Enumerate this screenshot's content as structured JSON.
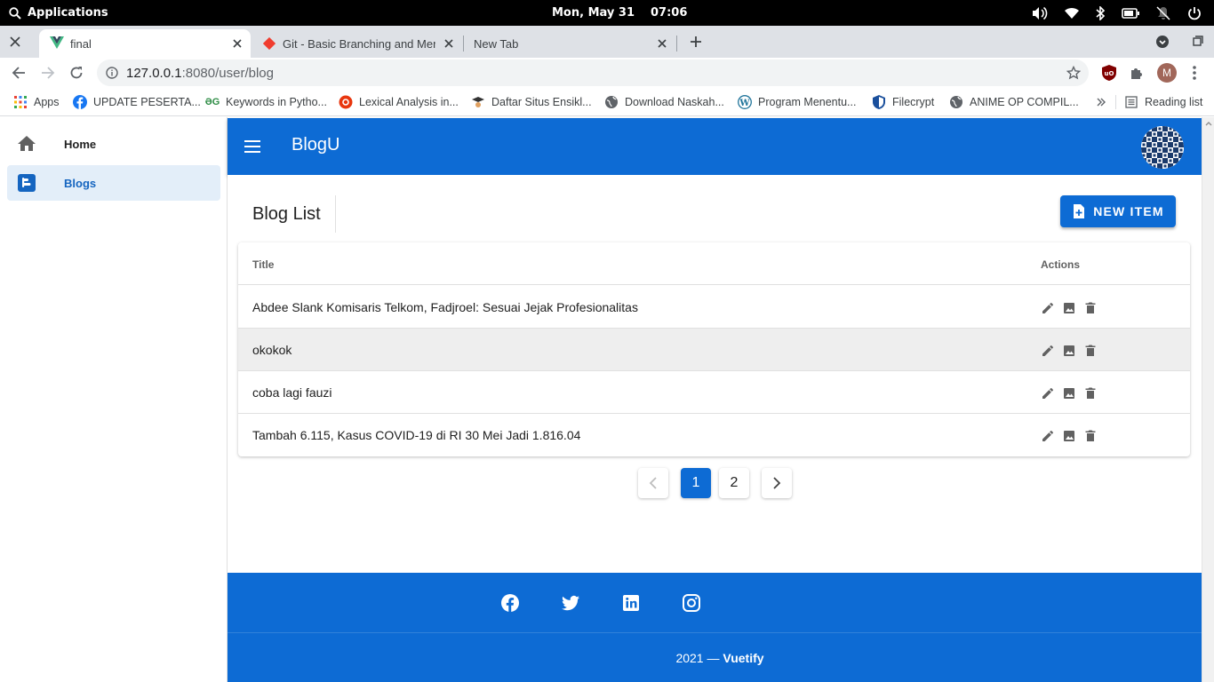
{
  "system_bar": {
    "applications_label": "Applications",
    "date": "Mon, May 31",
    "time": "07:06"
  },
  "browser": {
    "tabs": [
      {
        "label": "final",
        "icon": "vue-icon",
        "active": true
      },
      {
        "label": "Git - Basic Branching and Merg",
        "icon": "git-icon",
        "active": false
      },
      {
        "label": "New Tab",
        "icon": "",
        "active": false
      }
    ],
    "url_host": "127.0.0.1",
    "url_path": ":8080/user/blog",
    "profile_initial": "M",
    "bookmarks": [
      {
        "label": "Apps",
        "icon": "apps-grid-icon"
      },
      {
        "label": "UPDATE PESERTA...",
        "icon": "facebook-icon"
      },
      {
        "label": "Keywords in Pytho...",
        "icon": "geeksforgeeks-icon"
      },
      {
        "label": "Lexical Analysis in...",
        "icon": "red-circle-icon"
      },
      {
        "label": "Daftar Situs Ensikl...",
        "icon": "scholar-icon"
      },
      {
        "label": "Download Naskah...",
        "icon": "globe-icon"
      },
      {
        "label": "Program Menentu...",
        "icon": "wordpress-icon"
      },
      {
        "label": "Filecrypt",
        "icon": "shield-icon"
      },
      {
        "label": "ANIME OP COMPIL...",
        "icon": "globe-icon"
      }
    ],
    "reading_list_label": "Reading list"
  },
  "app": {
    "nav": [
      {
        "label": "Home",
        "icon": "home-icon",
        "active": false
      },
      {
        "label": "Blogs",
        "icon": "blogger-icon",
        "active": true
      }
    ],
    "title": "BlogU",
    "brand_color": "#0d6bd4",
    "page_title": "Blog List",
    "new_item_label": "NEW ITEM",
    "table": {
      "headers": [
        "Title",
        "Actions"
      ],
      "rows": [
        {
          "title": "Abdee Slank Komisaris Telkom, Fadjroel: Sesuai Jejak Profesionalitas"
        },
        {
          "title": "okokok"
        },
        {
          "title": "coba lagi fauzi"
        },
        {
          "title": "Tambah 6.115, Kasus COVID-19 di RI 30 Mei Jadi 1.816.04"
        }
      ],
      "action_icons": [
        "pencil-icon",
        "image-icon",
        "delete-icon"
      ]
    },
    "pagination": {
      "pages": [
        "1",
        "2"
      ],
      "current": "1"
    },
    "footer": {
      "social_icons": [
        "facebook-icon",
        "twitter-icon",
        "linkedin-icon",
        "instagram-icon"
      ],
      "year": "2021",
      "separator": "—",
      "brand": "Vuetify"
    }
  }
}
